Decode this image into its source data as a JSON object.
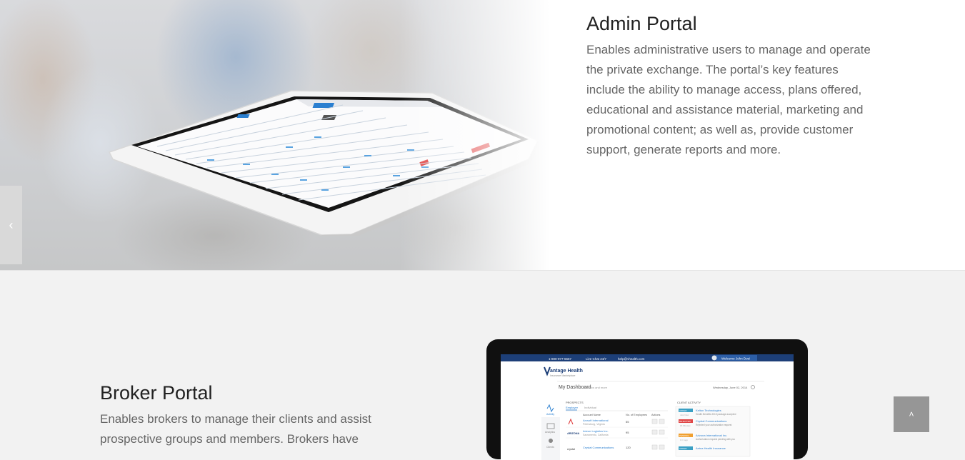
{
  "admin_section": {
    "title": "Admin Portal",
    "description": "Enables administrative users to manage and operate the private exchange. The portal’s key features include the ability to manage access, plans offered, educational and assistance material, marketing and promotional content; as well as, provide customer support, generate reports and more."
  },
  "broker_section": {
    "title": "Broker Portal",
    "description": "Enables brokers to manage their clients and assist prospective groups and members. Brokers have"
  },
  "laptop_screen": {
    "phone": "1-800-977-6667",
    "live_chat": "Live Chat 24/7",
    "email": "help@vhealth.com",
    "welcome": "Welcome John Doe!",
    "logo_text": "antage Health",
    "logo_sub": "Insurance Marketplace",
    "dashboard_title": "My Dashboard",
    "dashboard_sub": "Statistics and more",
    "date": "Wednesday, June 02, 2014",
    "prospects_label": "PROSPECTS",
    "tab_employer": "Employer",
    "tab_individual": "Individual",
    "col_account": "Account Name",
    "col_employees": "No. of Employees",
    "col_actions": "Actions",
    "client_activity": "CLIENT ACTIVITY",
    "nav_items": [
      "Activity",
      "Analytics",
      "Clients"
    ],
    "rows": [
      {
        "name": "Arcsoft International",
        "place": "Petersburg, Virginia",
        "count": "55"
      },
      {
        "name": "Arizon Logistics Inc.",
        "place": "Sacramento, California",
        "count": "95"
      },
      {
        "name": "Crystal Communications",
        "place": "",
        "count": "120"
      }
    ],
    "activity": [
      {
        "tag": "ADDED",
        "name": "Kelton Technologies",
        "desc": "Health Benefits 2015 package accepted",
        "time": "Just Now"
      },
      {
        "tag": "REJECTED",
        "name": "Crystal Communications",
        "desc": "Rejected your authorization request",
        "time": "15 Minutes"
      },
      {
        "tag": "PENDING",
        "name": "Arizona International Inc.",
        "desc": "Authorization request pending with you",
        "time": "1 hr ago"
      },
      {
        "tag": "ADDED",
        "name": "Aetna Health Insurance",
        "desc": "",
        "time": ""
      }
    ]
  },
  "controls": {
    "prev_arrow": "‹",
    "scroll_top_arrow": "˄"
  }
}
